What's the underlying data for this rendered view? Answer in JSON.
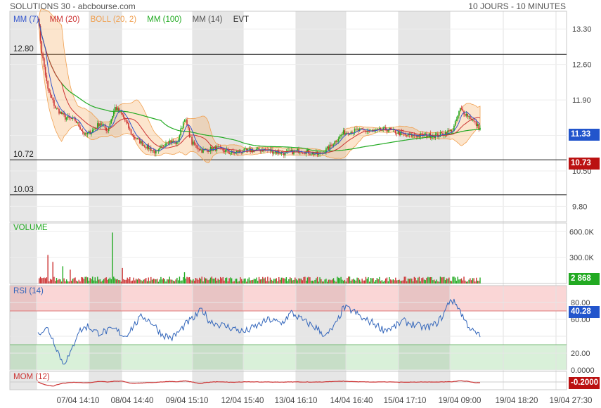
{
  "header": {
    "title": "SOLUTIONS 30 - abcbourse.com",
    "period": "10 JOURS - 10 MINUTES"
  },
  "legend": [
    {
      "label": "MM (7)",
      "color": "#3355cc"
    },
    {
      "label": "MM (20)",
      "color": "#cc3333"
    },
    {
      "label": "BOLL (20, 2)",
      "color": "#f0a050"
    },
    {
      "label": "MM (100)",
      "color": "#22aa22"
    },
    {
      "label": "MM (14)",
      "color": "#555555"
    },
    {
      "label": "EVT",
      "color": "#333333"
    }
  ],
  "colors": {
    "up": "#22aa22",
    "down": "#cc3333",
    "ma7": "#3355cc",
    "ma20": "#cc3333",
    "ma100": "#22aa22",
    "boll": "#f0a050",
    "rsi": "#3366bb",
    "mom": "#cc3333",
    "price_badge": "#2255cc",
    "level_badge": "#bb1111",
    "volume_badge": "#22aa22",
    "mom_badge": "#bb1111"
  },
  "chart_data": {
    "type": "candlestick",
    "x_tick_labels": [
      "07/04 14:10",
      "08/04 14:40",
      "09/04 15:10",
      "12/04 15:40",
      "13/04 16:10",
      "14/04 16:40",
      "15/04 17:10",
      "19/04 09:00",
      "19/04 18:20",
      "19/04 27:30"
    ],
    "price_panel": {
      "ylim": [
        9.5,
        13.65
      ],
      "y_ticks": [
        9.8,
        10.5,
        11.2,
        11.9,
        12.6,
        13.3
      ],
      "y_tick_labels": [
        "9.80",
        "10.50",
        "",
        "11.90",
        "12.60",
        "13.30"
      ],
      "horizontal_levels": [
        {
          "value": 12.8,
          "label": "12.80"
        },
        {
          "value": 10.72,
          "label": "10.72"
        },
        {
          "value": 10.03,
          "label": "10.03"
        }
      ],
      "last_price": "11.33",
      "level_badge": "10.73",
      "close_anchors": [
        [
          0,
          13.55
        ],
        [
          3,
          12.85
        ],
        [
          8,
          12.1
        ],
        [
          14,
          11.75
        ],
        [
          22,
          11.55
        ],
        [
          30,
          11.5
        ],
        [
          38,
          11.2
        ],
        [
          44,
          11.3
        ],
        [
          50,
          11.45
        ],
        [
          56,
          11.3
        ],
        [
          62,
          11.75
        ],
        [
          68,
          11.6
        ],
        [
          76,
          11.2
        ],
        [
          86,
          11.0
        ],
        [
          96,
          10.85
        ],
        [
          104,
          11.1
        ],
        [
          112,
          11.05
        ],
        [
          118,
          11.55
        ],
        [
          124,
          11.05
        ],
        [
          132,
          10.9
        ],
        [
          144,
          10.95
        ],
        [
          156,
          10.85
        ],
        [
          168,
          10.9
        ],
        [
          182,
          10.92
        ],
        [
          198,
          10.85
        ],
        [
          212,
          10.9
        ],
        [
          226,
          10.82
        ],
        [
          234,
          10.95
        ],
        [
          246,
          11.25
        ],
        [
          258,
          11.3
        ],
        [
          270,
          11.28
        ],
        [
          282,
          11.32
        ],
        [
          296,
          11.2
        ],
        [
          308,
          11.2
        ],
        [
          322,
          11.2
        ],
        [
          334,
          11.3
        ],
        [
          340,
          11.72
        ],
        [
          348,
          11.55
        ],
        [
          356,
          11.33
        ]
      ]
    },
    "volume_panel": {
      "y_tick_labels": [
        "300.0K",
        "600.0K"
      ],
      "y_ticks": [
        300000,
        600000
      ],
      "ylim": [
        0,
        700000
      ],
      "last_value": "2 868",
      "label": "VOLUME"
    },
    "rsi_panel": {
      "label": "RSI (14)",
      "ylim": [
        0,
        100
      ],
      "y_ticks": [
        0,
        20,
        40,
        60,
        80
      ],
      "y_tick_labels": [
        "0.0000",
        "20.00",
        "",
        "60.00",
        "80.00"
      ],
      "overbought": 70,
      "oversold": 30,
      "last_value": "40.28",
      "anchors": [
        [
          0,
          45
        ],
        [
          8,
          49
        ],
        [
          14,
          30
        ],
        [
          20,
          8
        ],
        [
          26,
          18
        ],
        [
          32,
          45
        ],
        [
          40,
          52
        ],
        [
          48,
          44
        ],
        [
          56,
          46
        ],
        [
          62,
          48
        ],
        [
          70,
          40
        ],
        [
          78,
          54
        ],
        [
          84,
          64
        ],
        [
          92,
          56
        ],
        [
          100,
          42
        ],
        [
          108,
          38
        ],
        [
          114,
          46
        ],
        [
          120,
          56
        ],
        [
          126,
          62
        ],
        [
          132,
          72
        ],
        [
          138,
          58
        ],
        [
          146,
          54
        ],
        [
          156,
          50
        ],
        [
          166,
          45
        ],
        [
          176,
          52
        ],
        [
          186,
          60
        ],
        [
          196,
          55
        ],
        [
          204,
          68
        ],
        [
          214,
          58
        ],
        [
          224,
          50
        ],
        [
          232,
          40
        ],
        [
          240,
          54
        ],
        [
          246,
          74
        ],
        [
          254,
          70
        ],
        [
          262,
          60
        ],
        [
          270,
          56
        ],
        [
          278,
          48
        ],
        [
          286,
          50
        ],
        [
          294,
          58
        ],
        [
          302,
          54
        ],
        [
          312,
          50
        ],
        [
          320,
          54
        ],
        [
          326,
          64
        ],
        [
          332,
          84
        ],
        [
          338,
          76
        ],
        [
          344,
          58
        ],
        [
          350,
          46
        ],
        [
          356,
          40
        ]
      ]
    },
    "mom_panel": {
      "label": "MOM (12)",
      "last_value": "-0.2000"
    }
  }
}
